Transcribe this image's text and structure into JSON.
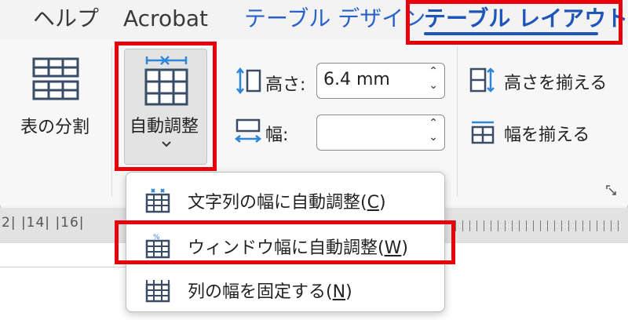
{
  "tabs": {
    "help": "ヘルプ",
    "acrobat": "Acrobat",
    "table_design": "テーブル デザイン",
    "table_layout": "テーブル レイアウト"
  },
  "ribbon": {
    "split_table": "表の分割",
    "autofit": "自動調整",
    "height_label": "高さ:",
    "height_value": "6.4 mm",
    "width_label": "幅:",
    "width_value": "",
    "distribute_rows": "高さを揃える",
    "distribute_cols": "幅を揃える"
  },
  "ruler": {
    "marks": "2|  |14|  |16|"
  },
  "menu": {
    "items": [
      {
        "label": "文字列の幅に自動調整(",
        "key": "C",
        "close": ")"
      },
      {
        "label": "ウィンドウ幅に自動調整(",
        "key": "W",
        "close": ")"
      },
      {
        "label": "列の幅を固定する(",
        "key": "N",
        "close": ")"
      }
    ]
  },
  "colors": {
    "highlight": "#e8000b",
    "accent": "#1d56b8",
    "icon_blue": "#2f86d6"
  }
}
